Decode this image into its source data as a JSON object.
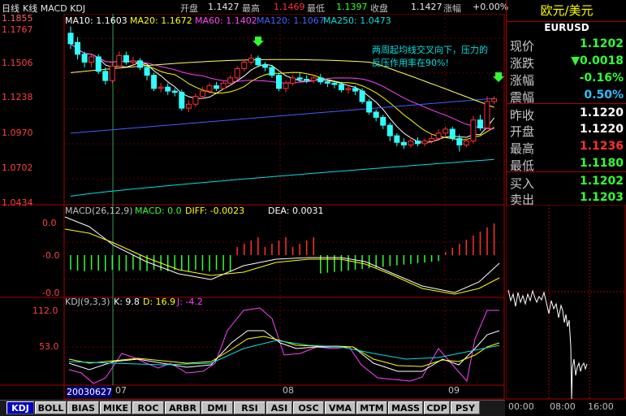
{
  "top_bar": {
    "period": "日线",
    "indicator_names": "K线 MACD KDJ",
    "open_label": "开盘",
    "open_value": "1.1427",
    "high_label": "最高",
    "high_value": "1.1469",
    "low_label": "最低",
    "low_value": "1.1397",
    "close_label": "收盘",
    "close_value": "1.1427",
    "change_label": "涨幅",
    "change_value": "+0.00%"
  },
  "ma_legend": {
    "ma10": "MA10: 1.1603",
    "ma20": "MA20: 1.1672",
    "ma60": "MA60: 1.1402",
    "ma120": "MA120: 1.1067",
    "ma250": "MA250: 1.0473"
  },
  "price_axis": [
    "1.1855",
    "1.1767",
    "1.1506",
    "1.1238",
    "1.0970",
    "1.0702",
    "1.0434"
  ],
  "annotation": {
    "line1": "两周起均线交叉向下，压力的",
    "line2": "反压作用率在90%!"
  },
  "macd_legend": {
    "name": "MACD(26,12,9)",
    "macd": "MACD: 0.0",
    "diff": "DIFF: -0.0023",
    "dea": "DEA: 0.0031"
  },
  "macd_axis": [
    "0.0",
    "-0.0",
    "-0.0"
  ],
  "kdj_legend": {
    "name": "KDJ(9,3,3)",
    "k": "K: 9.8",
    "d": "D: 16.9",
    "j": "J: -4.2"
  },
  "kdj_axis": [
    "112.0",
    "53.0"
  ],
  "date_axis": {
    "cursor_date": "20030627",
    "months": [
      "07",
      "08",
      "09"
    ]
  },
  "right_panel": {
    "title": "欧元/美元",
    "code": "EURUSD",
    "rows": [
      {
        "label": "现价",
        "value": "1.1202",
        "color": "#30ff30"
      },
      {
        "label": "涨跌",
        "value": "▼0.0018",
        "color": "#30ff30"
      },
      {
        "label": "涨幅",
        "value": "-0.16%",
        "color": "#30ff30"
      },
      {
        "label": "震幅",
        "value": "0.50%",
        "color": "#30c0ff"
      },
      {
        "label": "昨收",
        "value": "1.1220",
        "color": "#ffffff"
      },
      {
        "label": "开盘",
        "value": "1.1220",
        "color": "#ffffff"
      },
      {
        "label": "最高",
        "value": "1.1236",
        "color": "#ff3030"
      },
      {
        "label": "最低",
        "value": "1.1180",
        "color": "#30ff30"
      },
      {
        "label": "买入",
        "value": "1.1202",
        "color": "#30ff30"
      },
      {
        "label": "卖出",
        "value": "1.1203",
        "color": "#30ff30"
      }
    ]
  },
  "intraday_axis": [
    "00:00",
    "08:00",
    "16:00"
  ],
  "tabs": [
    "KDJ",
    "BOLL",
    "BIAS",
    "MIKE",
    "ROC",
    "ARBR",
    "DMI",
    "RSI",
    "ASI",
    "OSC",
    "VMA",
    "MTM",
    "MASS",
    "CDP",
    "PSY"
  ],
  "active_tab": "KDJ",
  "colors": {
    "up": "#ff3030",
    "down": "#30ffff",
    "ma10": "#ffffff",
    "ma20": "#ffff00",
    "ma60": "#ff40ff",
    "ma120": "#4060ff",
    "ma250": "#00e0e0",
    "frame": "#aa0000"
  },
  "chart_data": {
    "type": "candlestick",
    "candles": [
      {
        "o": 1.172,
        "c": 1.164,
        "h": 1.177,
        "l": 1.16
      },
      {
        "o": 1.165,
        "c": 1.156,
        "h": 1.169,
        "l": 1.152
      },
      {
        "o": 1.156,
        "c": 1.15,
        "h": 1.158,
        "l": 1.146
      },
      {
        "o": 1.15,
        "c": 1.154,
        "h": 1.156,
        "l": 1.146
      },
      {
        "o": 1.154,
        "c": 1.143,
        "h": 1.156,
        "l": 1.141
      },
      {
        "o": 1.143,
        "c": 1.136,
        "h": 1.146,
        "l": 1.133
      },
      {
        "o": 1.136,
        "c": 1.147,
        "h": 1.15,
        "l": 1.134
      },
      {
        "o": 1.147,
        "c": 1.155,
        "h": 1.158,
        "l": 1.145
      },
      {
        "o": 1.155,
        "c": 1.15,
        "h": 1.158,
        "l": 1.148
      },
      {
        "o": 1.15,
        "c": 1.151,
        "h": 1.154,
        "l": 1.147
      },
      {
        "o": 1.151,
        "c": 1.146,
        "h": 1.153,
        "l": 1.144
      },
      {
        "o": 1.146,
        "c": 1.14,
        "h": 1.147,
        "l": 1.136
      },
      {
        "o": 1.14,
        "c": 1.13,
        "h": 1.142,
        "l": 1.128
      },
      {
        "o": 1.13,
        "c": 1.131,
        "h": 1.134,
        "l": 1.127
      },
      {
        "o": 1.131,
        "c": 1.128,
        "h": 1.134,
        "l": 1.125
      },
      {
        "o": 1.128,
        "c": 1.127,
        "h": 1.13,
        "l": 1.124
      },
      {
        "o": 1.127,
        "c": 1.115,
        "h": 1.129,
        "l": 1.113
      },
      {
        "o": 1.115,
        "c": 1.118,
        "h": 1.121,
        "l": 1.112
      },
      {
        "o": 1.118,
        "c": 1.124,
        "h": 1.126,
        "l": 1.116
      },
      {
        "o": 1.124,
        "c": 1.128,
        "h": 1.131,
        "l": 1.122
      },
      {
        "o": 1.128,
        "c": 1.132,
        "h": 1.134,
        "l": 1.126
      },
      {
        "o": 1.132,
        "c": 1.13,
        "h": 1.135,
        "l": 1.128
      },
      {
        "o": 1.13,
        "c": 1.134,
        "h": 1.136,
        "l": 1.129
      },
      {
        "o": 1.134,
        "c": 1.138,
        "h": 1.14,
        "l": 1.132
      },
      {
        "o": 1.138,
        "c": 1.145,
        "h": 1.147,
        "l": 1.136
      },
      {
        "o": 1.145,
        "c": 1.15,
        "h": 1.152,
        "l": 1.143
      },
      {
        "o": 1.15,
        "c": 1.153,
        "h": 1.156,
        "l": 1.148
      },
      {
        "o": 1.153,
        "c": 1.148,
        "h": 1.155,
        "l": 1.146
      },
      {
        "o": 1.148,
        "c": 1.146,
        "h": 1.15,
        "l": 1.143
      },
      {
        "o": 1.146,
        "c": 1.14,
        "h": 1.148,
        "l": 1.138
      },
      {
        "o": 1.14,
        "c": 1.13,
        "h": 1.142,
        "l": 1.128
      },
      {
        "o": 1.13,
        "c": 1.134,
        "h": 1.136,
        "l": 1.127
      },
      {
        "o": 1.134,
        "c": 1.138,
        "h": 1.14,
        "l": 1.132
      },
      {
        "o": 1.138,
        "c": 1.137,
        "h": 1.142,
        "l": 1.135
      },
      {
        "o": 1.137,
        "c": 1.136,
        "h": 1.14,
        "l": 1.134
      },
      {
        "o": 1.136,
        "c": 1.138,
        "h": 1.14,
        "l": 1.134
      },
      {
        "o": 1.138,
        "c": 1.135,
        "h": 1.141,
        "l": 1.133
      },
      {
        "o": 1.135,
        "c": 1.134,
        "h": 1.137,
        "l": 1.131
      },
      {
        "o": 1.134,
        "c": 1.133,
        "h": 1.136,
        "l": 1.13
      },
      {
        "o": 1.133,
        "c": 1.129,
        "h": 1.135,
        "l": 1.127
      },
      {
        "o": 1.129,
        "c": 1.13,
        "h": 1.133,
        "l": 1.126
      },
      {
        "o": 1.13,
        "c": 1.128,
        "h": 1.132,
        "l": 1.125
      },
      {
        "o": 1.128,
        "c": 1.12,
        "h": 1.13,
        "l": 1.118
      },
      {
        "o": 1.12,
        "c": 1.112,
        "h": 1.122,
        "l": 1.11
      },
      {
        "o": 1.112,
        "c": 1.108,
        "h": 1.114,
        "l": 1.105
      },
      {
        "o": 1.108,
        "c": 1.102,
        "h": 1.11,
        "l": 1.099
      },
      {
        "o": 1.102,
        "c": 1.094,
        "h": 1.104,
        "l": 1.09
      },
      {
        "o": 1.094,
        "c": 1.089,
        "h": 1.096,
        "l": 1.086
      },
      {
        "o": 1.089,
        "c": 1.087,
        "h": 1.092,
        "l": 1.084
      },
      {
        "o": 1.087,
        "c": 1.09,
        "h": 1.093,
        "l": 1.085
      },
      {
        "o": 1.09,
        "c": 1.088,
        "h": 1.093,
        "l": 1.086
      },
      {
        "o": 1.088,
        "c": 1.09,
        "h": 1.092,
        "l": 1.086
      },
      {
        "o": 1.09,
        "c": 1.092,
        "h": 1.095,
        "l": 1.088
      },
      {
        "o": 1.092,
        "c": 1.096,
        "h": 1.099,
        "l": 1.09
      },
      {
        "o": 1.096,
        "c": 1.099,
        "h": 1.101,
        "l": 1.094
      },
      {
        "o": 1.099,
        "c": 1.092,
        "h": 1.101,
        "l": 1.09
      },
      {
        "o": 1.092,
        "c": 1.087,
        "h": 1.095,
        "l": 1.082
      },
      {
        "o": 1.087,
        "c": 1.09,
        "h": 1.092,
        "l": 1.085
      },
      {
        "o": 1.09,
        "c": 1.106,
        "h": 1.109,
        "l": 1.088
      },
      {
        "o": 1.106,
        "c": 1.1,
        "h": 1.11,
        "l": 1.098
      },
      {
        "o": 1.1,
        "c": 1.12,
        "h": 1.124,
        "l": 1.099
      },
      {
        "o": 1.12,
        "c": 1.122,
        "h": 1.124,
        "l": 1.118
      }
    ],
    "ylim": [
      1.0434,
      1.1855
    ]
  }
}
